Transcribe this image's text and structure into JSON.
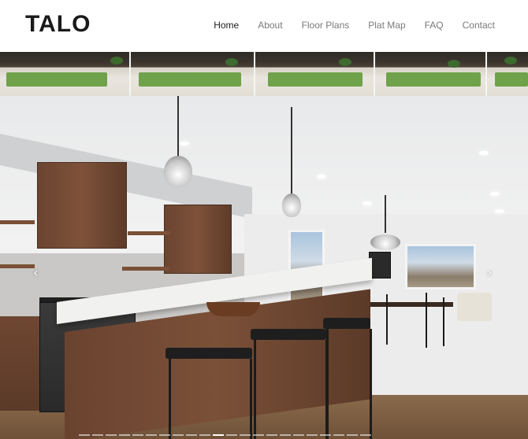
{
  "site": {
    "logo": "TALO"
  },
  "nav": {
    "items": [
      {
        "label": "Home",
        "active": true
      },
      {
        "label": "About",
        "active": false
      },
      {
        "label": "Floor Plans",
        "active": false
      },
      {
        "label": "Plat Map",
        "active": false
      },
      {
        "label": "FAQ",
        "active": false
      },
      {
        "label": "Contact",
        "active": false
      }
    ]
  },
  "slider": {
    "prev_icon": "‹",
    "next_icon": "›",
    "slide_count": 22,
    "active_index": 10
  },
  "colors": {
    "nav_active": "#1d1d1d",
    "nav_inactive": "#7a7a7a",
    "cabinet_wood": "#6b4430",
    "counter": "#f1f1ef"
  }
}
